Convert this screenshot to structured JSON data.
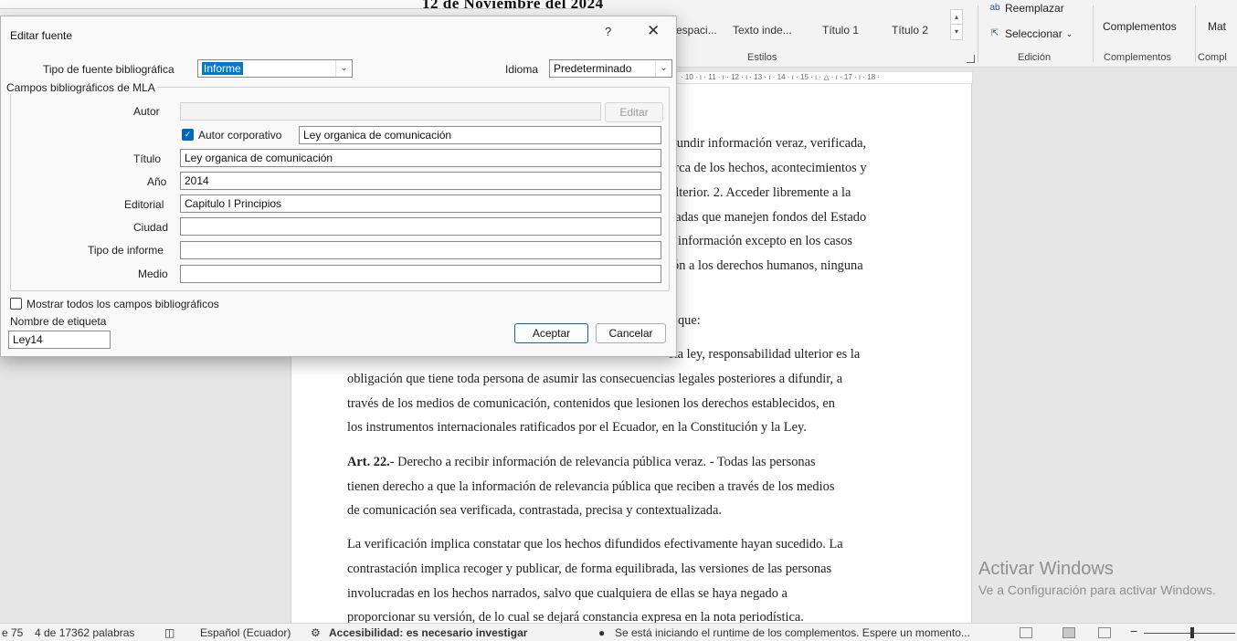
{
  "ribbon": {
    "doc_title_partial": "12 de Noviembre del 2024",
    "styles": [
      "espaci...",
      "Texto inde...",
      "Título 1",
      "Título 2"
    ],
    "group_estilos": "Estilos",
    "replace": "Reemplazar",
    "select": "Seleccionar",
    "group_edicion": "Edición",
    "complementos_btn": "Complementos",
    "group_complementos": "Complementos",
    "math_cut": "Mat",
    "compl_cut": "Compl"
  },
  "ruler": "· 10 · ı · 11 · ı · 12 · ı · 13 · ı · 14 · ı · 15 · ı · △ · ı · 17 · ı · 18 ·",
  "document": {
    "lines": [
      "ifundir información veraz, verificada,",
      "erca de los hechos, acontecimientos y",
      "ulterior. 2. Acceder libremente a la",
      "vadas que manejen fondos del Estado",
      "e información excepto en los casos",
      "ión a los derechos humanos, ninguna",
      "a que:",
      "sta ley, responsabilidad ulterior es la",
      "obligación que tiene toda persona de asumir las consecuencias legales posteriores a difundir, a",
      "través de los medios de comunicación, contenidos que lesionen los derechos establecidos, en",
      "los instrumentos internacionales ratificados por el Ecuador, en la Constitución y la Ley.",
      "tienen derecho a que la información de relevancia pública que reciben a través de los medios",
      "de comunicación sea verificada, contrastada, precisa y contextualizada.",
      "La verificación implica constatar que los hechos difundidos efectivamente hayan sucedido. La",
      "contrastación implica recoger y publicar, de forma equilibrada, las versiones de las personas",
      "involucradas en los hechos narrados, salvo que cualquiera de ellas se haya negado a",
      "proporcionar su versión, de lo cual se dejará constancia expresa en la nota periodística."
    ],
    "art22_label": "Art. 22.",
    "art22_text": "- Derecho a recibir información de relevancia pública veraz. -  Todas las personas"
  },
  "watermark": {
    "title": "Activar Windows",
    "subtitle": "Ve a Configuración para activar Windows."
  },
  "statusbar": {
    "page_cut": "e 75",
    "words": "4 de 17362 palabras",
    "language": "Español (Ecuador)",
    "accessibility": "Accesibilidad: es necesario investigar",
    "addins": "Se está iniciando el runtime de los complementos. Espere un momento..."
  },
  "dialog": {
    "title": "Editar fuente",
    "help": "?",
    "close": "✕",
    "source_type_label": "Tipo de fuente bibliográfica",
    "source_type_value": "Informe",
    "language_label": "Idioma",
    "language_value": "Predeterminado",
    "group_label": "Campos bibliográficos de MLA",
    "author_label": "Autor",
    "author_value": "",
    "edit_button": "Editar",
    "corporate_author_label": "Autor corporativo",
    "corporate_author_checked": true,
    "corporate_author_value": "Ley organica de comunicación",
    "title_label": "Título",
    "title_value": "Ley organica de comunicación",
    "year_label": "Año",
    "year_value": "2014",
    "publisher_label": "Editorial",
    "publisher_value": "Capitulo I Principios",
    "city_label": "Ciudad",
    "city_value": "",
    "report_type_label": "Tipo de informe",
    "report_type_value": "",
    "medium_label": "Medio",
    "medium_value": "",
    "show_all_label": "Mostrar todos los campos bibliográficos",
    "show_all_checked": false,
    "tag_name_label": "Nombre de etiqueta",
    "tag_name_value": "Ley14",
    "ok_button": "Aceptar",
    "cancel_button": "Cancelar"
  }
}
